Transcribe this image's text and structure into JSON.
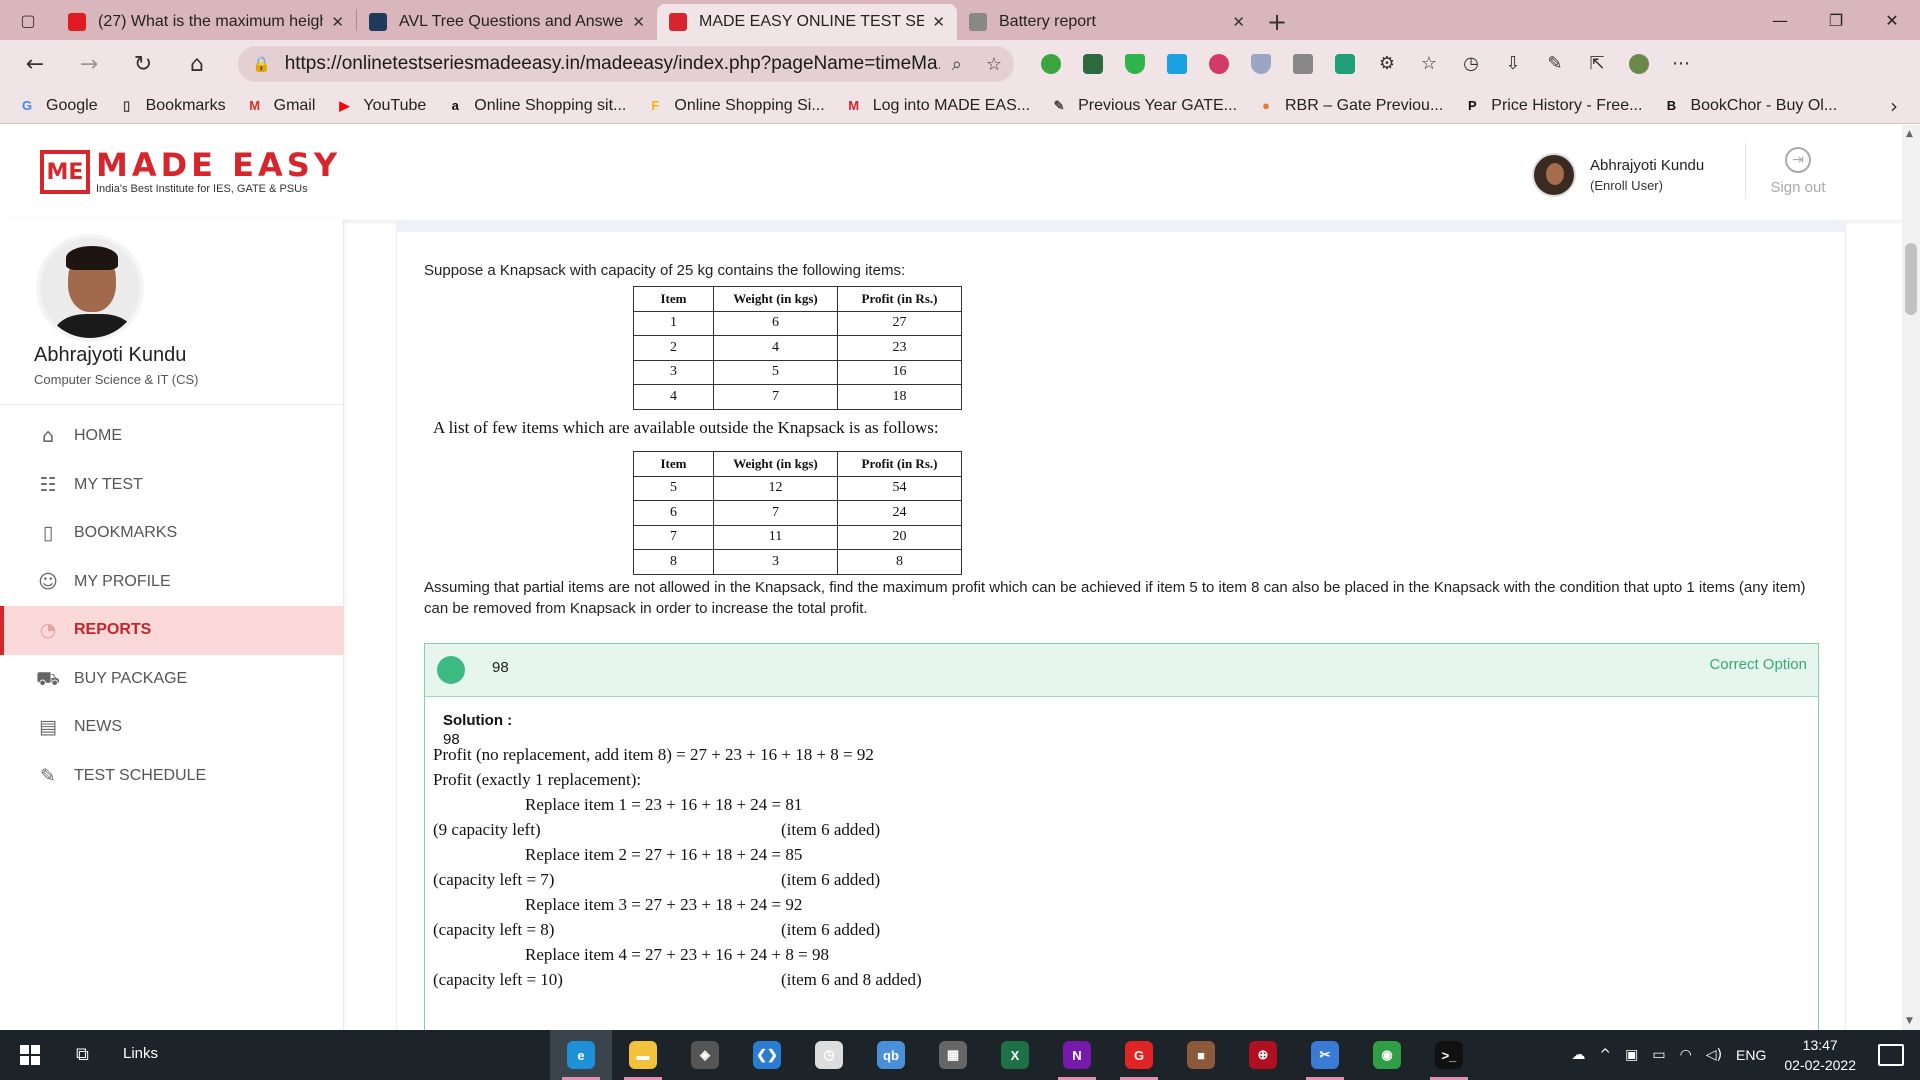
{
  "browser": {
    "tabs": [
      {
        "title": "(27) What is the maximum heigh",
        "icon": "quora-g-icon",
        "color": "#e11b22",
        "active": false
      },
      {
        "title": "AVL Tree Questions and Answers",
        "icon": "sanfoundry-icon",
        "color": "#1e3b5c",
        "active": false
      },
      {
        "title": "MADE EASY ONLINE TEST SERIES",
        "icon": "madeeasy-icon",
        "color": "#d6262c",
        "active": true
      },
      {
        "title": "Battery report",
        "icon": "page-icon",
        "color": "#888888",
        "active": false
      }
    ],
    "url": "https://onlinetestseriesmadeeasy.in/madeeasy/index.php?pageName=timeMa...",
    "bookmarks": [
      {
        "label": "Google",
        "icon": "G",
        "color": "#4285f4"
      },
      {
        "label": "Bookmarks",
        "icon": "▯",
        "color": "#444444"
      },
      {
        "label": "Gmail",
        "icon": "M",
        "color": "#d93025"
      },
      {
        "label": "YouTube",
        "icon": "▶",
        "color": "#ff0000"
      },
      {
        "label": "Online Shopping sit...",
        "icon": "a",
        "color": "#111111"
      },
      {
        "label": "Online Shopping Si...",
        "icon": "F",
        "color": "#f7b500"
      },
      {
        "label": "Log into MADE EAS...",
        "icon": "M",
        "color": "#d6262c"
      },
      {
        "label": "Previous Year GATE...",
        "icon": "✎",
        "color": "#444444"
      },
      {
        "label": "RBR – Gate Previou...",
        "icon": "●",
        "color": "#e07a30"
      },
      {
        "label": "Price History - Free...",
        "icon": "P",
        "color": "#111111"
      },
      {
        "label": "BookChor - Buy Ol...",
        "icon": "B",
        "color": "#111111"
      }
    ]
  },
  "header": {
    "logo_name": "MADE EASY",
    "logo_tagline": "India's Best Institute for IES, GATE & PSUs",
    "user_name": "Abhrajyoti Kundu",
    "user_role": "(Enroll User)",
    "signout_label": "Sign out"
  },
  "sidebar": {
    "name": "Abhrajyoti Kundu",
    "dept": "Computer Science & IT (CS)",
    "items": [
      {
        "label": "HOME",
        "icon": "⌂",
        "active": false
      },
      {
        "label": "MY TEST",
        "icon": "☷",
        "active": false
      },
      {
        "label": "BOOKMARKS",
        "icon": "▯",
        "active": false
      },
      {
        "label": "MY PROFILE",
        "icon": "☺",
        "active": false
      },
      {
        "label": "REPORTS",
        "icon": "◔",
        "active": true
      },
      {
        "label": "BUY PACKAGE",
        "icon": "⛟",
        "active": false
      },
      {
        "label": "NEWS",
        "icon": "▤",
        "active": false
      },
      {
        "label": "TEST SCHEDULE",
        "icon": "✎",
        "active": false
      }
    ]
  },
  "question": {
    "intro": "Suppose a Knapsack with capacity of 25 kg contains the following items:",
    "table_headers": [
      "Item",
      "Weight (in kgs)",
      "Profit (in Rs.)"
    ],
    "inside_items": [
      [
        "1",
        "6",
        "27"
      ],
      [
        "2",
        "4",
        "23"
      ],
      [
        "3",
        "5",
        "16"
      ],
      [
        "4",
        "7",
        "18"
      ]
    ],
    "middle_text": "A list of few items which are available outside the Knapsack is as follows:",
    "outside_items": [
      [
        "5",
        "12",
        "54"
      ],
      [
        "6",
        "7",
        "24"
      ],
      [
        "7",
        "11",
        "20"
      ],
      [
        "8",
        "3",
        "8"
      ]
    ],
    "tail": "Assuming that partial items are not allowed in the Knapsack, find the maximum profit which can be achieved if item 5 to item 8 can also be placed in the Knapsack with the condition that upto 1 items (any item) can be removed from Knapsack in order to increase the total profit."
  },
  "answer": {
    "value": "98",
    "tag": "Correct Option",
    "solution_label": "Solution :",
    "solution_value": "98",
    "lines": [
      "Profit (no replacement, add item 8) = 27 + 23 + 16 + 18 + 8 = 92",
      "Profit (exactly 1 replacement):",
      "Replace item 1  =  23 + 16 + 18 + 24 = 81",
      "(9 capacity left)",
      "(item 6 added)",
      "Replace item 2  =  27 + 16 + 18 + 24 = 85",
      "(capacity left = 7)",
      "(item 6 added)",
      "Replace item 3  =  27 + 23 + 18 + 24 = 92",
      "(capacity left = 8)",
      "(item 6 added)",
      "Replace item 4  =  27 + 23 + 16 + 24 + 8 = 98",
      "(capacity left = 10)",
      "(item 6 and 8 added)"
    ]
  },
  "taskbar": {
    "links_label": "Links",
    "apps": [
      {
        "name": "edge",
        "letter": "e",
        "color": "#1f8fd6"
      },
      {
        "name": "file-explorer",
        "letter": "▬",
        "color": "#f3c23c"
      },
      {
        "name": "unity",
        "letter": "◈",
        "color": "#555555"
      },
      {
        "name": "vscode",
        "letter": "❮❯",
        "color": "#2a7cd0"
      },
      {
        "name": "clock",
        "letter": "◷",
        "color": "#dddddd"
      },
      {
        "name": "qbittorrent",
        "letter": "qb",
        "color": "#4a90d9"
      },
      {
        "name": "calculator",
        "letter": "▦",
        "color": "#666666"
      },
      {
        "name": "excel",
        "letter": "X",
        "color": "#1e7145"
      },
      {
        "name": "onenote",
        "letter": "N",
        "color": "#7719aa"
      },
      {
        "name": "app-red",
        "letter": "G",
        "color": "#e02424"
      },
      {
        "name": "app-brown",
        "letter": "■",
        "color": "#8a5a3a"
      },
      {
        "name": "app-dark",
        "letter": "⊕",
        "color": "#b01020"
      },
      {
        "name": "snip",
        "letter": "✂",
        "color": "#3a7bd5"
      },
      {
        "name": "chrome",
        "letter": "◉",
        "color": "#2f9e44"
      },
      {
        "name": "terminal",
        "letter": ">_",
        "color": "#111111"
      }
    ],
    "language": "ENG",
    "time": "13:47",
    "date": "02-02-2022"
  }
}
